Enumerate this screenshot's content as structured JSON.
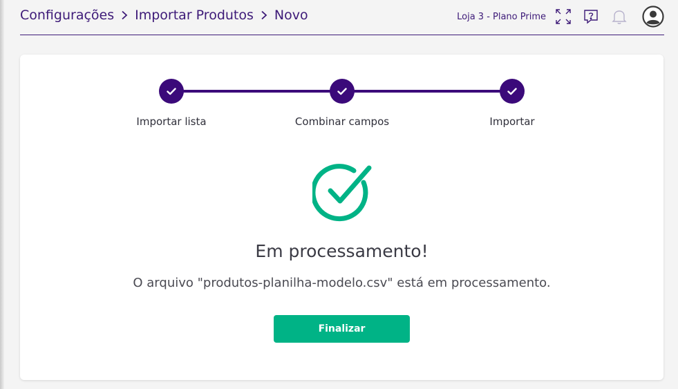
{
  "breadcrumb": {
    "items": [
      "Configurações",
      "Importar Produtos",
      "Novo"
    ]
  },
  "header": {
    "store_label": "Loja 3 - Plano Prime",
    "icons": [
      "fullscreen-icon",
      "help-icon",
      "bell-icon",
      "avatar-icon"
    ]
  },
  "stepper": {
    "steps": [
      {
        "label": "Importar lista",
        "status": "complete"
      },
      {
        "label": "Combinar campos",
        "status": "complete"
      },
      {
        "label": "Importar",
        "status": "complete"
      }
    ]
  },
  "status": {
    "title": "Em processamento!",
    "message": "O arquivo \"produtos-planilha-modelo.csv\" está em processamento."
  },
  "actions": {
    "finish_label": "Finalizar"
  },
  "colors": {
    "brand": "#3b0a7a",
    "success": "#00b386",
    "background": "#f4f4f4"
  }
}
